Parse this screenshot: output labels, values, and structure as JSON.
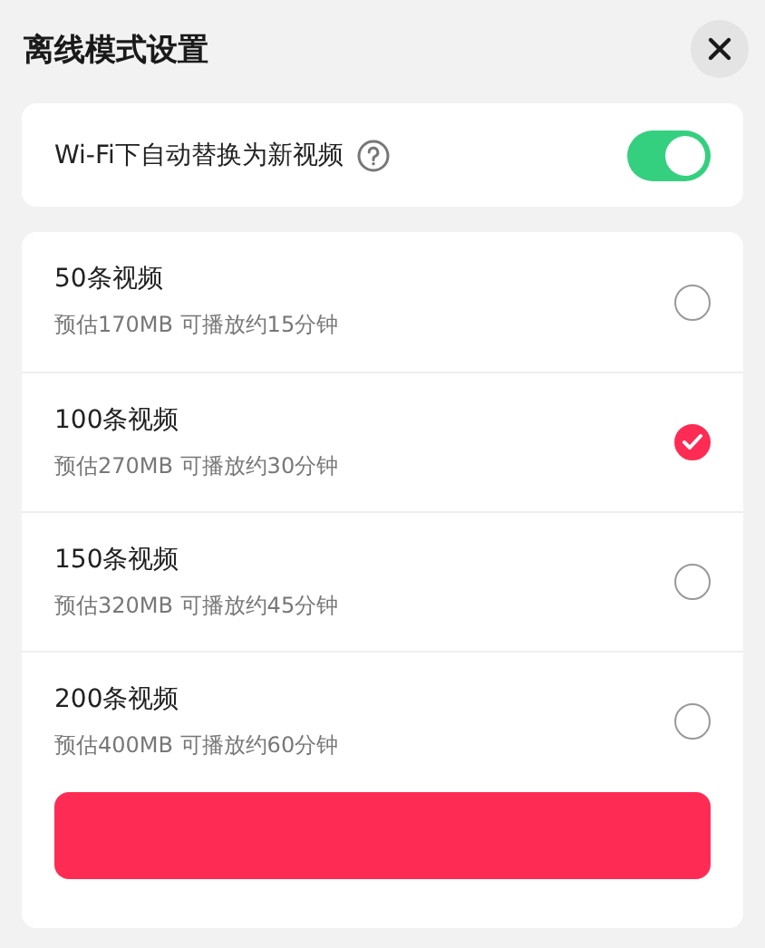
{
  "title": "离线模式设置",
  "wifi_option": {
    "label": "Wi-Fi下自动替换为新视频",
    "on": true
  },
  "options": [
    {
      "name": "50条视频",
      "detail": "预估170MB 可播放约15分钟",
      "selected": false
    },
    {
      "name": "100条视频",
      "detail": "预估270MB 可播放约30分钟",
      "selected": true
    },
    {
      "name": "150条视频",
      "detail": "预估320MB 可播放约45分钟",
      "selected": false
    },
    {
      "name": "200条视频",
      "detail": "预估400MB 可播放约60分钟",
      "selected": false
    }
  ]
}
